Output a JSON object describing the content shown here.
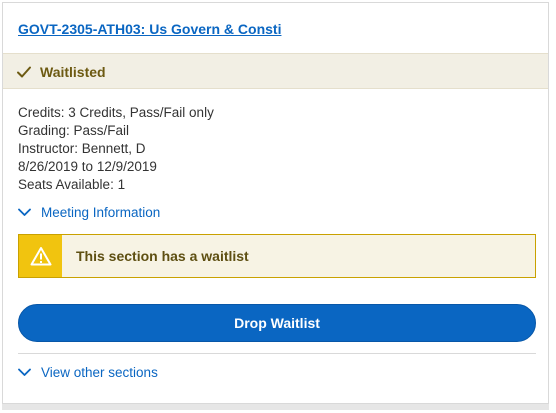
{
  "course": {
    "title": "GOVT-2305-ATH03: Us Govern & Consti"
  },
  "status": {
    "label": "Waitlisted",
    "icon": "check-icon"
  },
  "details": {
    "credits": "Credits: 3 Credits, Pass/Fail only",
    "grading": "Grading: Pass/Fail",
    "instructor": "Instructor: Bennett, D",
    "dates": "8/26/2019 to 12/9/2019",
    "seats": "Seats Available:  1"
  },
  "meeting_toggle": {
    "label": "Meeting Information",
    "icon": "chevron-down-icon"
  },
  "alert": {
    "message": "This section has a waitlist",
    "icon": "warning-icon"
  },
  "drop_button": {
    "label": "Drop Waitlist"
  },
  "sections_toggle": {
    "label": "View other sections",
    "icon": "chevron-down-icon"
  },
  "colors": {
    "link": "#0a66c2",
    "status_bg": "#f2efe4",
    "status_text": "#6d5a12",
    "alert_bg": "#f7f3e4",
    "alert_icon_bg": "#f1c40f",
    "button_bg": "#0a66c2"
  }
}
